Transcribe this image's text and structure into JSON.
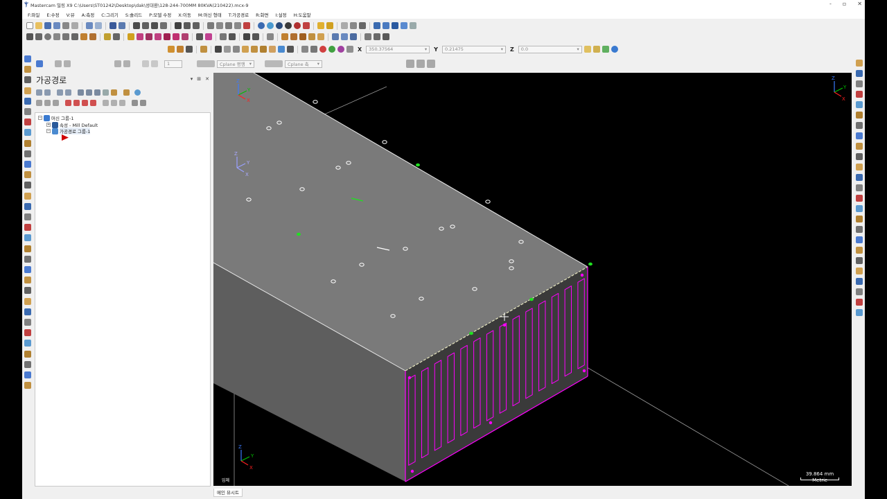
{
  "window": {
    "title": "Mastercam 밀링 X9  C:\\Users\\ST01242\\Desktop\\dak\\성대환\\128-244-700MM 80KVA(210422).mcx-9",
    "minimize": "-",
    "restore": "▫",
    "close": "✕"
  },
  "menu": [
    "F:파일",
    "E:수정",
    "V:뷰",
    "A:측정",
    "C:그리기",
    "S:솔리드",
    "P:모델 수정",
    "X:이동",
    "M:머신 형태",
    "T:가공경로",
    "R:화면",
    "I:설정",
    "H:도움말"
  ],
  "coords": {
    "x_label": "X",
    "x_value": "350.37564",
    "y_label": "Y",
    "y_value": "0.21475",
    "z_label": "Z",
    "z_value": "0.0"
  },
  "toolbar3": {
    "level_value": "1",
    "cplane_label": "Cplane 평행",
    "cplane_axis": "Cplane 축"
  },
  "panel": {
    "title": "가공경로",
    "pin": "▾",
    "dock": "⊞",
    "close": "✕",
    "tree": {
      "machine_group": "머신 그룹-1",
      "properties": "속성 - Mill Default",
      "toolpath_group": "가공경로 그룹-1"
    }
  },
  "viewport": {
    "corner_label": "임체",
    "scale_value": "39.864 mm",
    "scale_unit": "Metric",
    "background": "#000000",
    "part_top_color": "#7a7a7a",
    "part_side_color": "#5a5a5a",
    "feature_color": "#ff00ff"
  },
  "statusbar": {
    "viewsheet_tab": "메인 뷰시트"
  }
}
